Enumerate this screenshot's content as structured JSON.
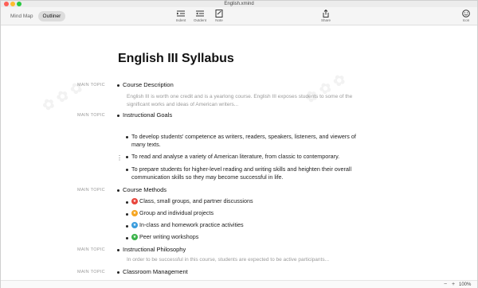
{
  "window": {
    "title": "English.xmind"
  },
  "toolbar": {
    "tabs": [
      "Mind Map",
      "Outliner"
    ],
    "active_tab": "Outliner",
    "indent_label": "Indent",
    "outdent_label": "Outdent",
    "note_label": "Note",
    "share_label": "Share",
    "icon_label": "Icon"
  },
  "document": {
    "title": "English III Syllabus",
    "topic_label": "MAIN TOPIC",
    "topics": [
      {
        "text": "Course Description",
        "note": "English III is worth one credit and is a yearlong course. English III exposes students to some of the significant works and ideas of American writers..."
      },
      {
        "text": "Instructional Goals",
        "subtopics": [
          "To develop students' competence as writers, readers, speakers, listeners, and viewers of many texts.",
          "To read and analyse a variety of American literature, from classic to contemporary.",
          "To prepare students for higher-level reading and writing skills and heighten their overall communication skills so they may become successful in life."
        ]
      },
      {
        "text": "Course Methods",
        "subtopics": [
          "Class, small groups, and partner discussions",
          "Group and individual projects",
          "In-class and homework practice activities",
          "Peer writing workshops"
        ]
      },
      {
        "text": "Instructional Philosophy",
        "note": "In order to be successful in this course, students are expected to be active participants..."
      },
      {
        "text": "Classroom Management"
      }
    ]
  },
  "markers": {
    "colors": [
      "#e8453c",
      "#f5a623",
      "#3b9ddd",
      "#3bb34a"
    ],
    "icons": [
      "star-icon",
      "star-icon",
      "star-icon",
      "star-icon"
    ]
  },
  "status": {
    "zoom": "100%",
    "zoom_minus": "−",
    "zoom_plus": "+"
  }
}
